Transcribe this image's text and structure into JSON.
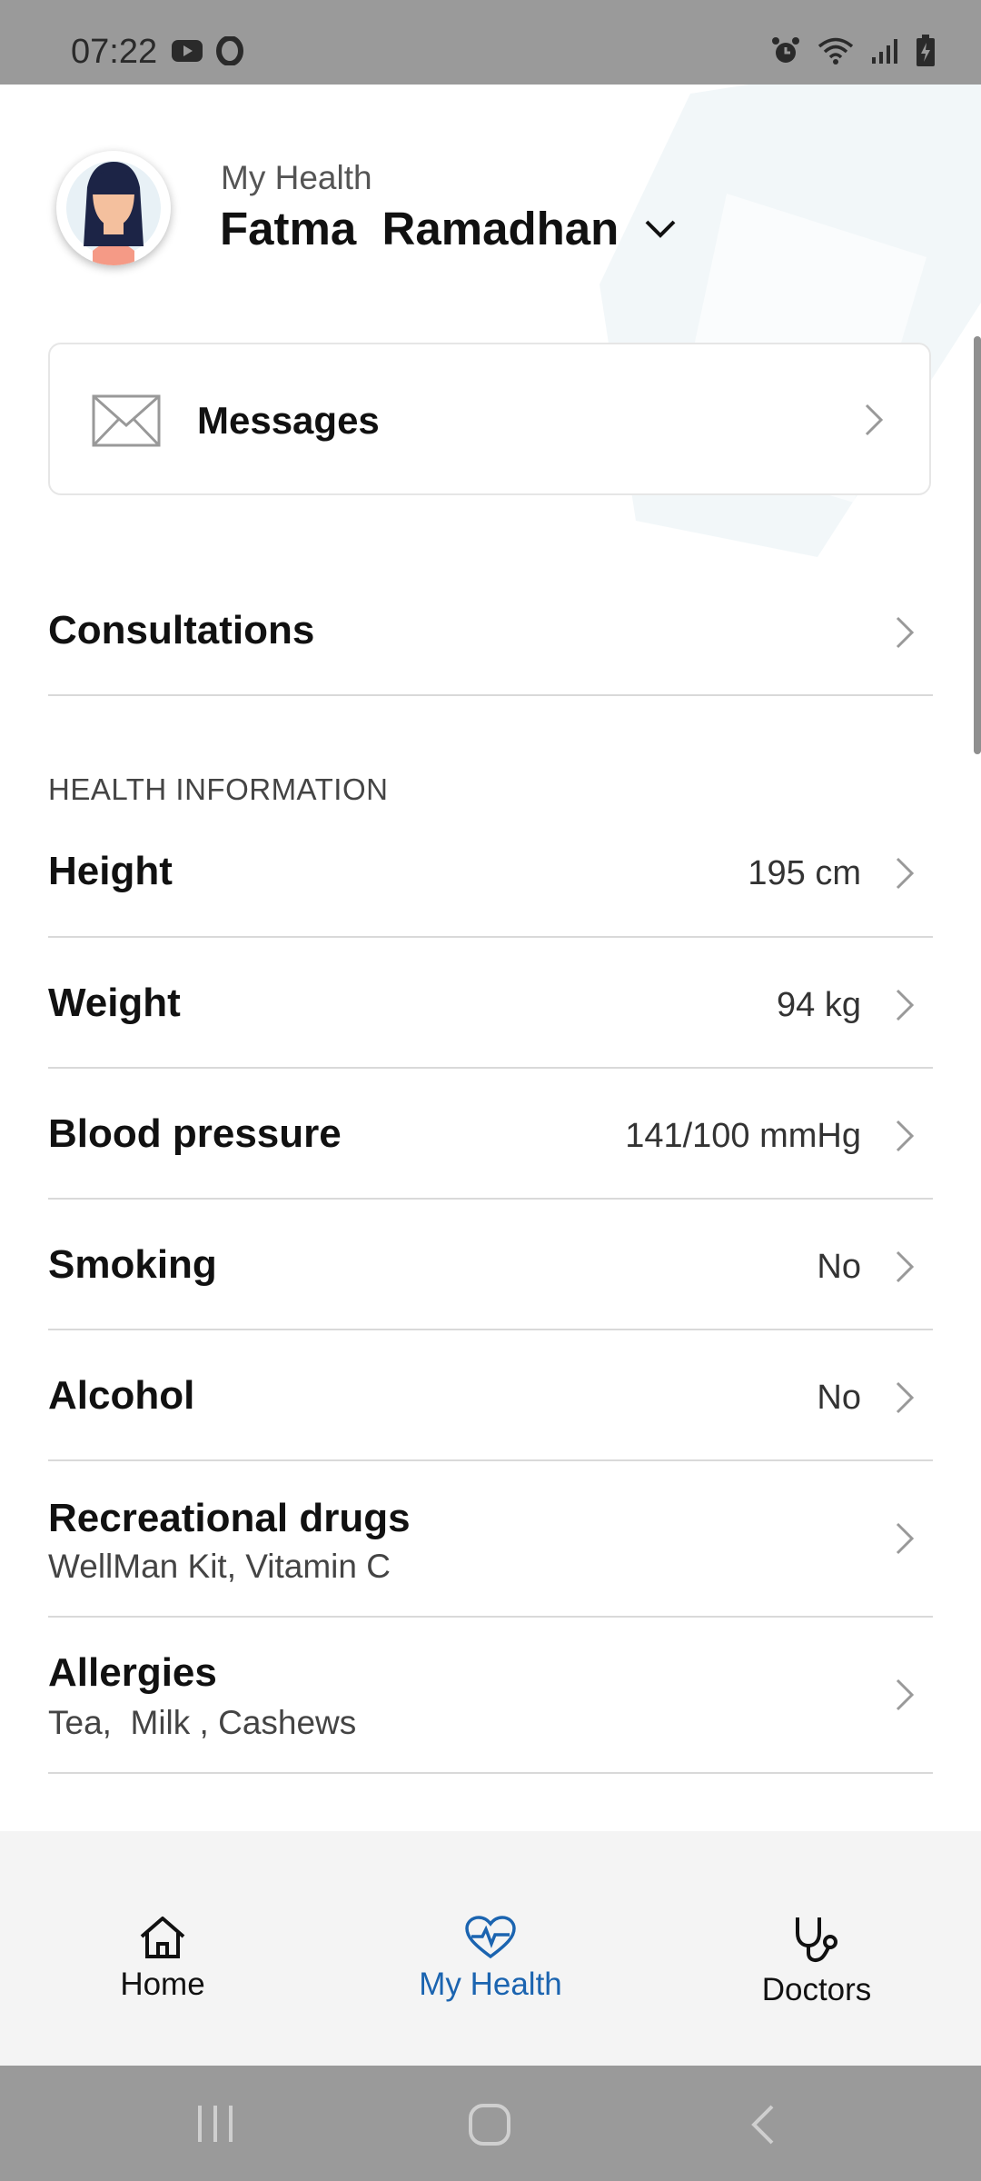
{
  "status_bar": {
    "time": "07:22",
    "left_icons": [
      "youtube-icon",
      "opera-icon"
    ],
    "right_icons": [
      "alarm-icon",
      "wifi-icon",
      "signal-icon",
      "battery-icon"
    ]
  },
  "header": {
    "subtitle": "My Health",
    "name": "Fatma  Ramadhan"
  },
  "messages": {
    "label": "Messages"
  },
  "consultations": {
    "label": "Consultations"
  },
  "health_info": {
    "section_title": "HEALTH INFORMATION",
    "items": [
      {
        "label": "Height",
        "value": "195 cm"
      },
      {
        "label": "Weight",
        "value": "94 kg"
      },
      {
        "label": "Blood pressure",
        "value": "141/100 mmHg"
      },
      {
        "label": "Smoking",
        "value": "No"
      },
      {
        "label": "Alcohol",
        "value": "No"
      },
      {
        "label": "Recreational drugs",
        "sub": "WellMan Kit, Vitamin C"
      },
      {
        "label": "Allergies",
        "sub": "Tea,  Milk , Cashews"
      }
    ]
  },
  "bottom_nav": {
    "items": [
      {
        "label": "Home",
        "icon": "home-icon"
      },
      {
        "label": "My Health",
        "icon": "heart-pulse-icon",
        "active": true
      },
      {
        "label": "Doctors",
        "icon": "stethoscope-icon"
      }
    ],
    "active_color": "#1b64b0"
  }
}
